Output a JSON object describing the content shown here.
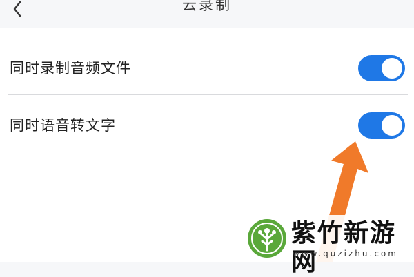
{
  "header": {
    "title": "云录制",
    "back_icon": "chevron-left-icon"
  },
  "settings": [
    {
      "label": "同时录制音频文件",
      "enabled": true
    },
    {
      "label": "同时语音转文字",
      "enabled": true
    }
  ],
  "colors": {
    "accent": "#1f78e6",
    "arrow": "#f07a2a",
    "background": "#f6f7f9"
  },
  "watermark": {
    "name": "紫竹新游网",
    "url": "www.quzizhu.com"
  }
}
